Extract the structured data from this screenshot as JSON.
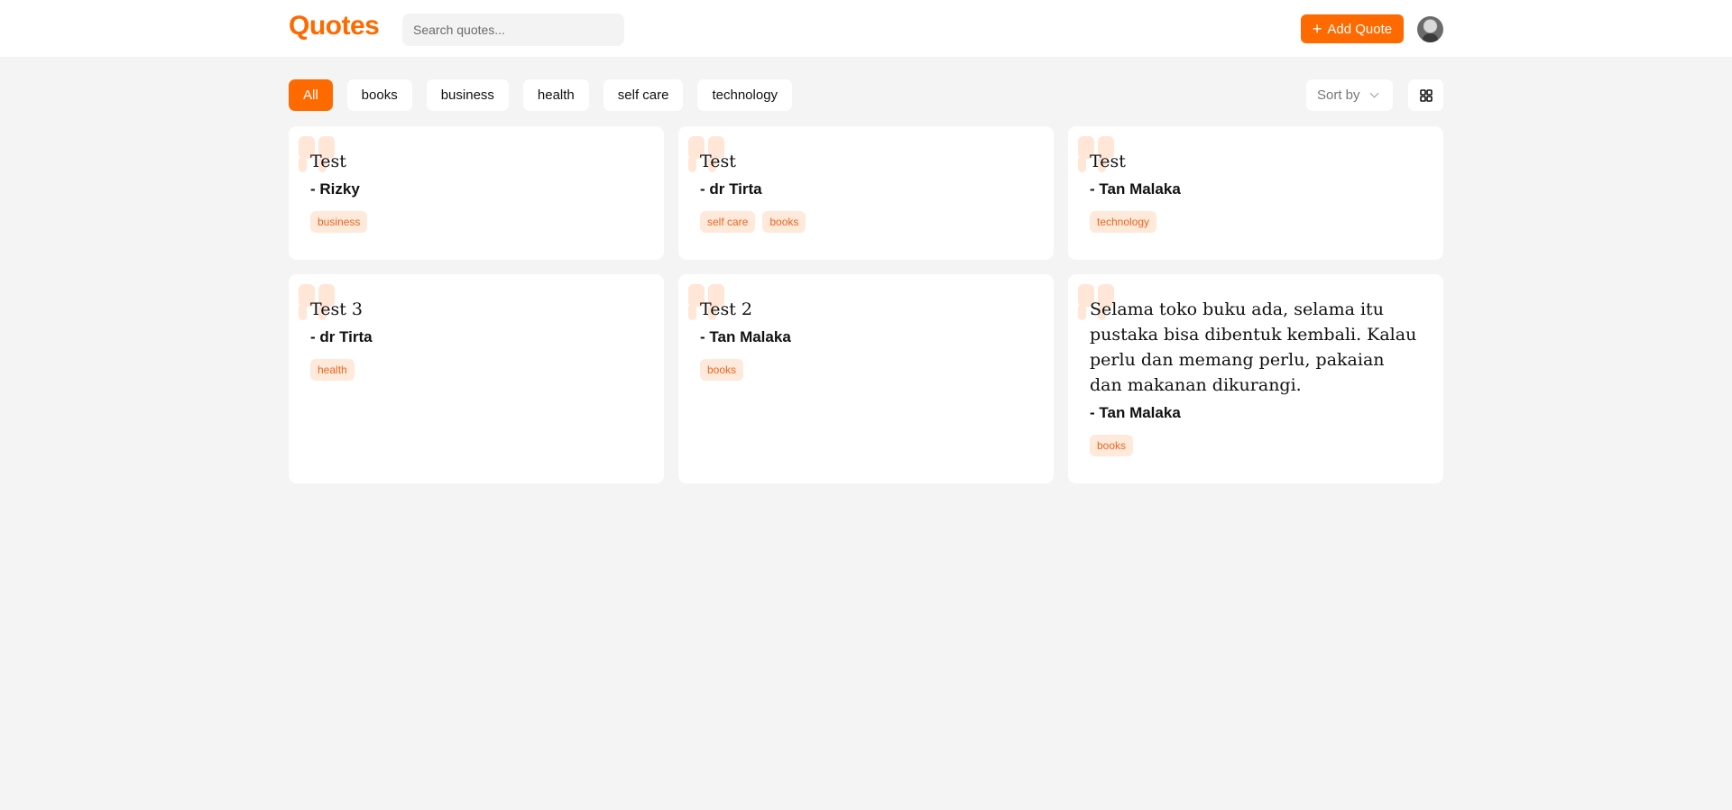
{
  "header": {
    "logo": "Quotes",
    "search_placeholder": "Search quotes...",
    "add_button": "Add Quote"
  },
  "filters": [
    "All",
    "books",
    "business",
    "health",
    "self care",
    "technology"
  ],
  "active_filter": "All",
  "sort_label": "Sort by",
  "colors": {
    "accent": "#ff6a00",
    "tag_bg": "#ffe9db",
    "tag_text": "#e8661e",
    "page_bg": "#f4f4f4"
  },
  "quotes": [
    {
      "text": "Test",
      "author": "- Rizky",
      "tags": [
        "business"
      ]
    },
    {
      "text": "Test",
      "author": "- dr Tirta",
      "tags": [
        "self care",
        "books"
      ]
    },
    {
      "text": "Test",
      "author": "- Tan Malaka",
      "tags": [
        "technology"
      ]
    },
    {
      "text": "Test 3",
      "author": "- dr Tirta",
      "tags": [
        "health"
      ]
    },
    {
      "text": "Test 2",
      "author": "- Tan Malaka",
      "tags": [
        "books"
      ]
    },
    {
      "text": "Selama toko buku ada, selama itu pustaka bisa dibentuk kembali. Kalau perlu dan memang perlu, pakaian dan makanan dikurangi.",
      "author": "- Tan Malaka",
      "tags": [
        "books"
      ]
    }
  ]
}
